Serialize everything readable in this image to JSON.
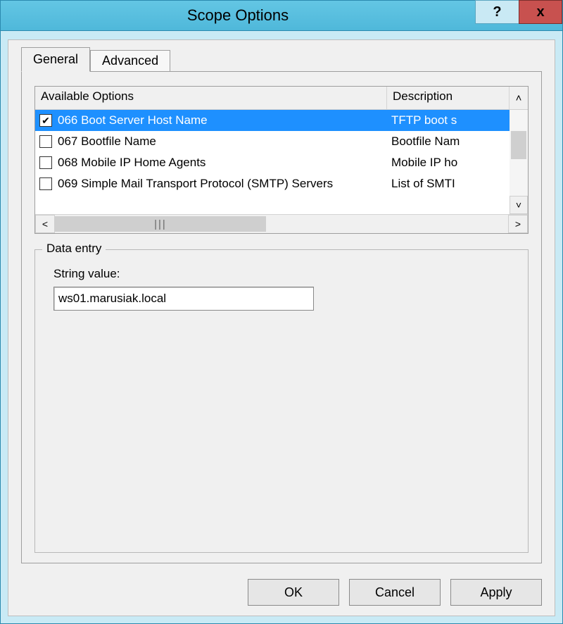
{
  "window": {
    "title": "Scope Options"
  },
  "tabs": {
    "general": "General",
    "advanced": "Advanced"
  },
  "columns": {
    "options": "Available Options",
    "description": "Description"
  },
  "rows": [
    {
      "checked": true,
      "option": "066 Boot Server Host Name",
      "desc": "TFTP boot s",
      "selected": true
    },
    {
      "checked": false,
      "option": "067 Bootfile Name",
      "desc": "Bootfile Nam",
      "selected": false
    },
    {
      "checked": false,
      "option": "068 Mobile IP Home Agents",
      "desc": "Mobile IP ho",
      "selected": false
    },
    {
      "checked": false,
      "option": "069 Simple Mail Transport Protocol (SMTP) Servers",
      "desc": "List of SMTI",
      "selected": false
    }
  ],
  "data_entry": {
    "group_label": "Data entry",
    "string_label": "String value:",
    "string_value": "ws01.marusiak.local"
  },
  "buttons": {
    "ok": "OK",
    "cancel": "Cancel",
    "apply": "Apply"
  },
  "scroll_glyphs": {
    "up": "˄",
    "down": "˅",
    "left": "<",
    "right": ">",
    "grip": "|||"
  }
}
